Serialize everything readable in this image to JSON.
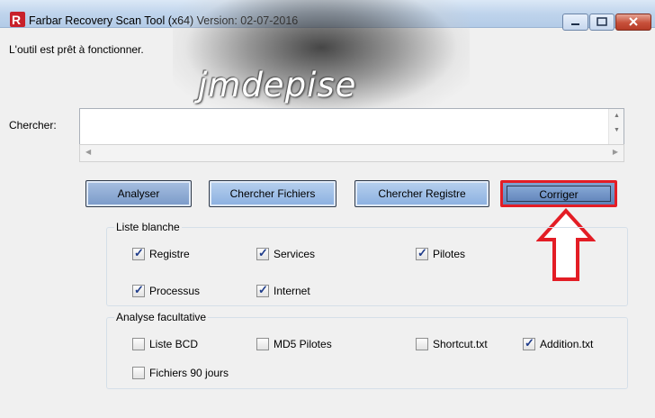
{
  "window": {
    "title": "Farbar Recovery Scan Tool (x64) Version: 02-07-2016",
    "buttons": {
      "minimize": "minimize",
      "maximize": "maximize",
      "close": "close"
    }
  },
  "watermark": "jmdepise",
  "status": "L'outil est prêt à fonctionner.",
  "search": {
    "label": "Chercher:",
    "value": ""
  },
  "toolbar": {
    "analyser": "Analyser",
    "chercher_fichiers": "Chercher Fichiers",
    "chercher_registre": "Chercher Registre",
    "corriger": "Corriger"
  },
  "whitelist": {
    "title": "Liste blanche",
    "items": [
      {
        "label": "Registre",
        "checked": true
      },
      {
        "label": "Services",
        "checked": true
      },
      {
        "label": "Pilotes",
        "checked": true
      },
      {
        "label": "Processus",
        "checked": true
      },
      {
        "label": "Internet",
        "checked": true
      }
    ]
  },
  "optional": {
    "title": "Analyse facultative",
    "items": [
      {
        "label": "Liste BCD",
        "checked": false
      },
      {
        "label": "MD5 Pilotes",
        "checked": false
      },
      {
        "label": "Shortcut.txt",
        "checked": false
      },
      {
        "label": "Addition.txt",
        "checked": true
      },
      {
        "label": "Fichiers 90 jours",
        "checked": false
      }
    ]
  },
  "colors": {
    "highlight": "#e31d25",
    "button": "#8aafe0"
  },
  "icons": {
    "app": "farbar-logo-icon",
    "annotation": "up-arrow-icon"
  }
}
